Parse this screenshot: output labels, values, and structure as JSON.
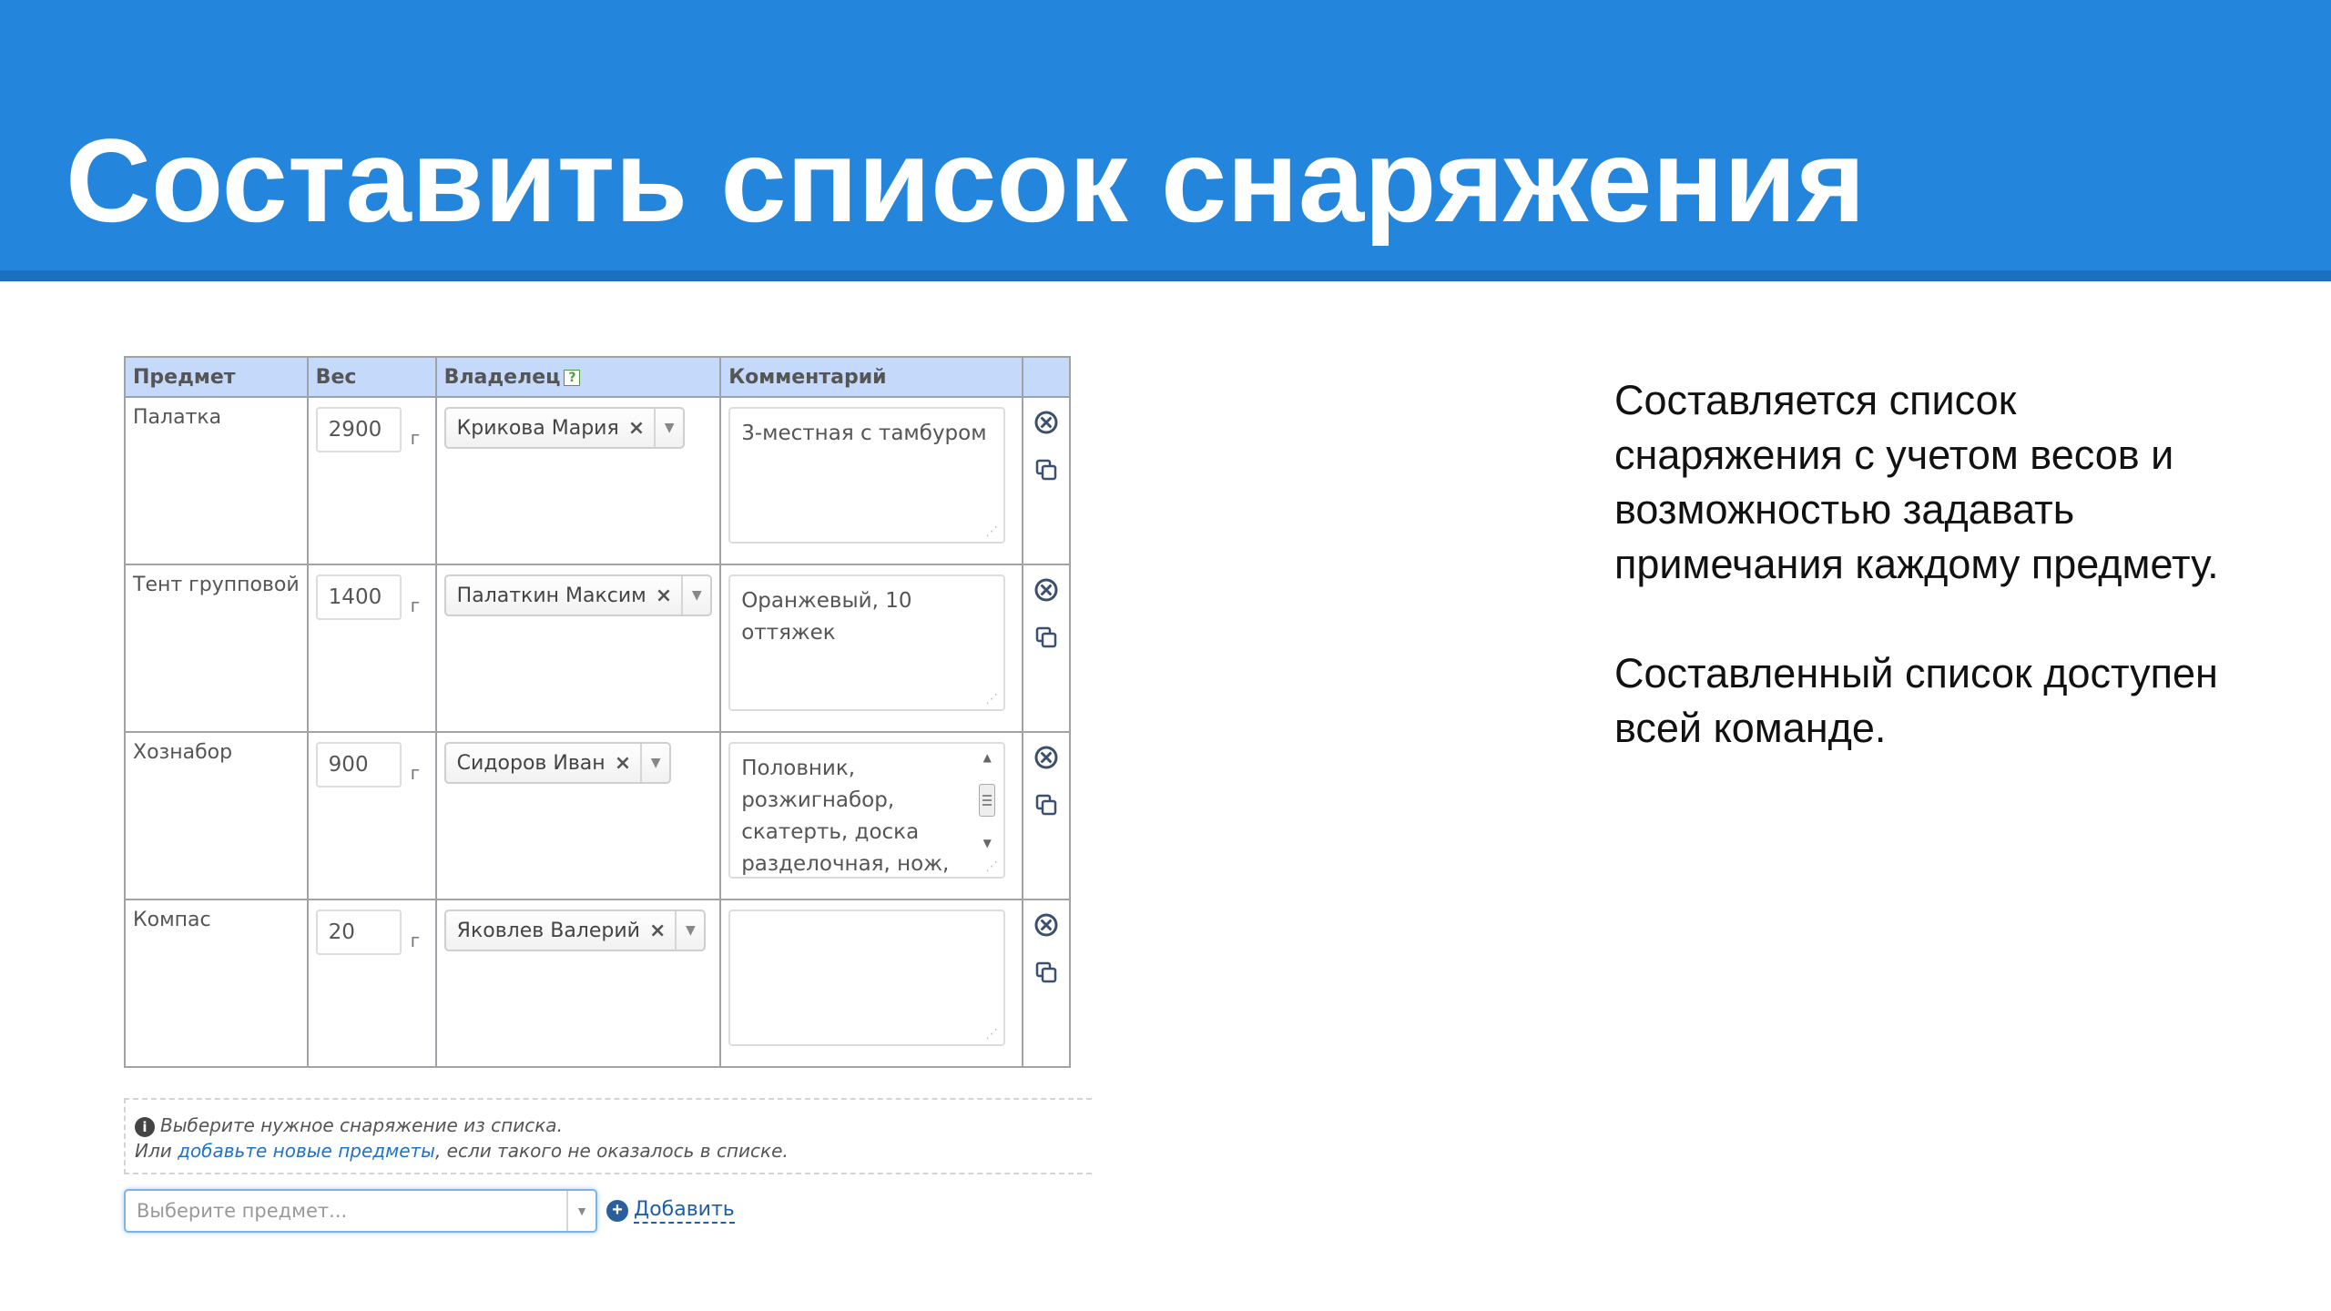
{
  "slide": {
    "title": "Составить список снаряжения"
  },
  "table": {
    "headers": {
      "item": "Предмет",
      "weight": "Вес",
      "owner": "Владелец",
      "owner_help": "?",
      "comment": "Комментарий"
    },
    "weight_unit": "г",
    "clear_symbol": "×",
    "rows": [
      {
        "item": "Палатка",
        "weight": "2900",
        "owner": "Крикова Мария",
        "comment": "3-местная с тамбуром"
      },
      {
        "item": "Тент групповой",
        "weight": "1400",
        "owner": "Палаткин Максим",
        "comment": "Оранжевый, 10 оттяжек"
      },
      {
        "item": "Хознабор",
        "weight": "900",
        "owner": "Сидоров Иван",
        "comment": "Половник,\nрозжигнабор,\nскатерть, доска\nразделочная, нож,"
      },
      {
        "item": "Компас",
        "weight": "20",
        "owner": "Яковлев Валерий",
        "comment": ""
      }
    ]
  },
  "info": {
    "icon": "i",
    "line1": "Выберите нужное снаряжение из списка.",
    "line2_prefix": "Или ",
    "line2_link": "добавьте новые предметы",
    "line2_suffix": ", если такого не оказалось в списке."
  },
  "add_item": {
    "placeholder": "Выберите предмет...",
    "add_icon": "+",
    "add_label": "Добавить"
  },
  "description": {
    "p1": "Составляется список снаряжения с учетом весов и возможностью задавать примечания каждому предмету.",
    "p2": "Составленный список доступен всей команде."
  },
  "colors": {
    "header_band": "#2385db",
    "table_header": "#c5d9fb",
    "link": "#1f73c8"
  }
}
